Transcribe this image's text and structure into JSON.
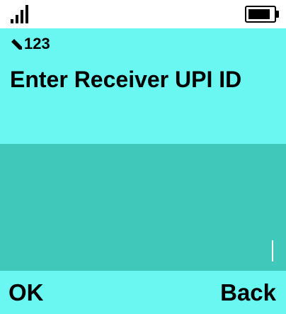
{
  "status_bar": {
    "signal_icon": "signal-strength-icon",
    "battery_icon": "battery-full-icon",
    "signal_level": "4 of 4 bars",
    "battery_level": "full"
  },
  "prompt": {
    "input_mode_icon": "pencil-icon",
    "input_mode": "123",
    "title": "Enter Receiver UPI ID",
    "background_color": "#6af7f1"
  },
  "input": {
    "value": "",
    "background_color": "#40c9bb"
  },
  "softkeys": {
    "left_label": "OK",
    "right_label": "Back"
  }
}
